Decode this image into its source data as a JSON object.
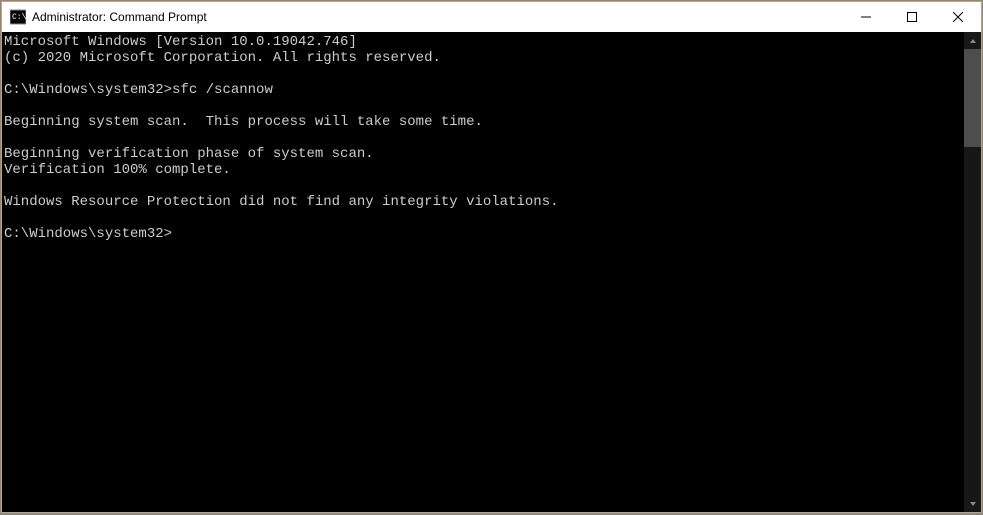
{
  "titlebar": {
    "title": "Administrator: Command Prompt"
  },
  "terminal": {
    "line1": "Microsoft Windows [Version 10.0.19042.746]",
    "line2": "(c) 2020 Microsoft Corporation. All rights reserved.",
    "blank1": "",
    "prompt1_path": "C:\\Windows\\system32>",
    "prompt1_cmd": "sfc /scannow",
    "blank2": "",
    "line3": "Beginning system scan.  This process will take some time.",
    "blank3": "",
    "line4": "Beginning verification phase of system scan.",
    "line5": "Verification 100% complete.",
    "blank4": "",
    "line6": "Windows Resource Protection did not find any integrity violations.",
    "blank5": "",
    "prompt2_path": "C:\\Windows\\system32>"
  }
}
